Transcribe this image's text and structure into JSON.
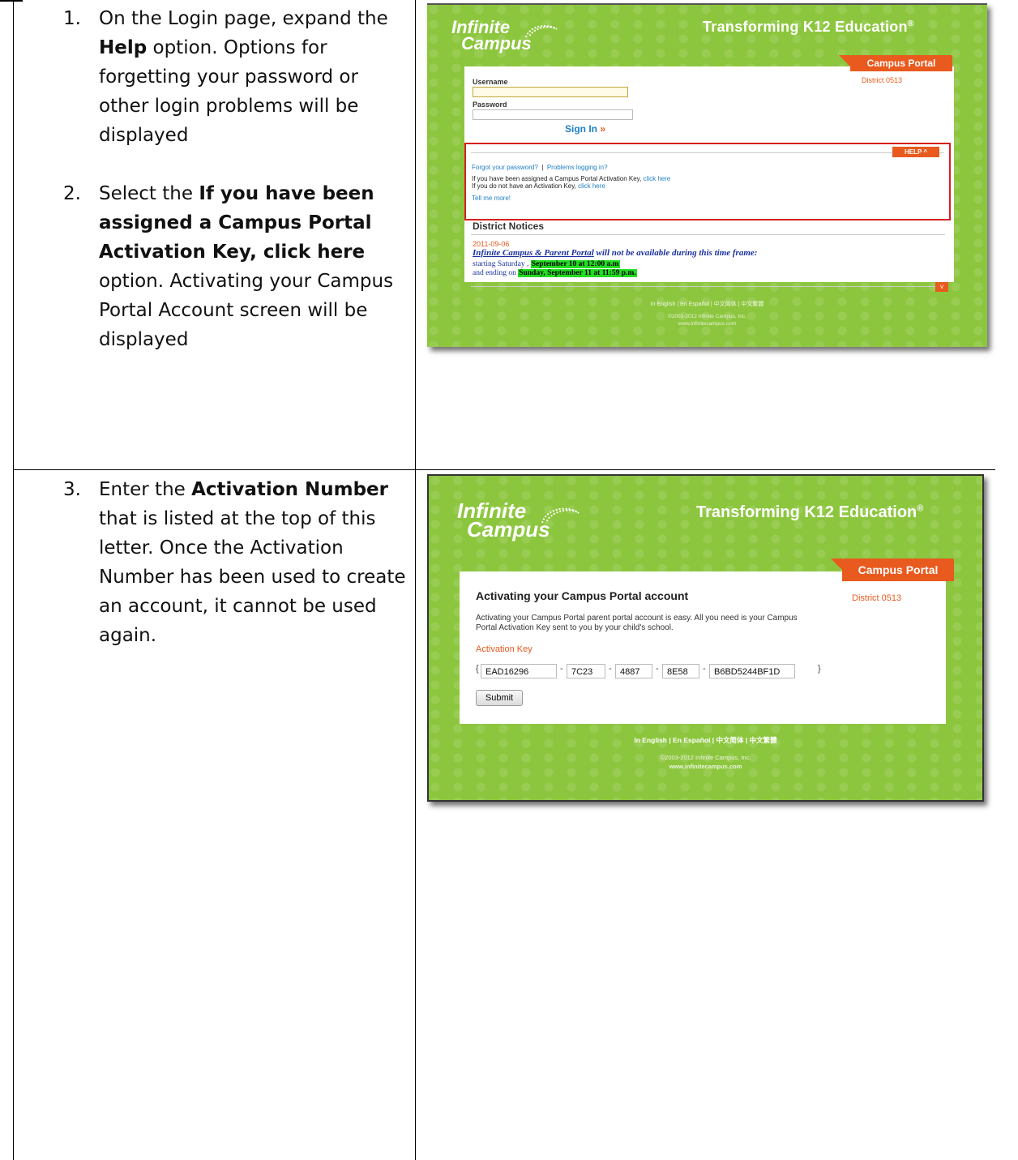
{
  "steps": [
    {
      "num": "1.",
      "pre": "On the Login page, expand the ",
      "bold": "Help",
      "post": " option. Options for forgetting your password or other login problems will be displayed"
    },
    {
      "num": "2.",
      "pre": "Select the ",
      "bold": "If you have been assigned a Campus Portal Activation Key, click here",
      "post": " option. Activating your Campus Portal Account screen will be displayed"
    },
    {
      "num": "3.",
      "pre": "Enter the ",
      "bold": "Activation Number",
      "post": " that is listed at the top of this letter. Once the Activation Number has been used to create an account, it cannot be used again."
    }
  ],
  "brand": {
    "logo_line1": "Infinite",
    "logo_line2": "Campus",
    "tagline": "Transforming K12 Education",
    "tagline_mark": "®",
    "portal_tab": "Campus Portal",
    "district": "District 0513",
    "footer_langs": "In English | En Español | 中文简体 | 中文繁體",
    "footer_copyright": "©2003-2012 Infinite Campus, Inc.",
    "footer_url": "www.infinitecampus.com"
  },
  "login_screen": {
    "username_label": "Username",
    "password_label": "Password",
    "sign_in": "Sign In",
    "sign_in_arrows": "»",
    "help_button": "HELP ^",
    "forgot_password": "Forgot your password?",
    "separator": "|",
    "problems_logging_in": "Problems logging in?",
    "assigned_key_text": "If you have been assigned a Campus Portal Activation Key,",
    "no_key_text": "If you do not have an Activation Key,",
    "click_here": "click here",
    "tell_me_more": "Tell me more!",
    "notices_title": "District Notices",
    "notice_date": "2011-09-06",
    "notice_title": "Infinite Campus & Parent Portal",
    "notice_title_rest": " will not be available during this time frame:",
    "notice_start_prefix": "starting Saturday , ",
    "notice_start": "September 10 at 12:00 a.m",
    "notice_end_prefix": "and ending on ",
    "notice_end": "Sunday, September 11 at 11:59 p.m.",
    "more_button": "v"
  },
  "activation_screen": {
    "heading": "Activating your Campus Portal account",
    "description": "Activating your Campus Portal parent portal account is easy. All you need is your Campus Portal Activation Key sent to you by your child's school.",
    "key_label": "Activation Key",
    "brace_open": "{",
    "brace_close": "}",
    "dash": "-",
    "key_parts": [
      "EAD16296",
      "7C23",
      "4887",
      "8E58",
      "B6BD5244BF1D"
    ],
    "submit_label": "Submit"
  },
  "colors": {
    "portal_green": "#8cc63e",
    "accent_orange": "#e85a1e",
    "link_blue": "#1e7fc4",
    "help_border_red": "#d62020",
    "highlight_green": "#22dd22"
  }
}
